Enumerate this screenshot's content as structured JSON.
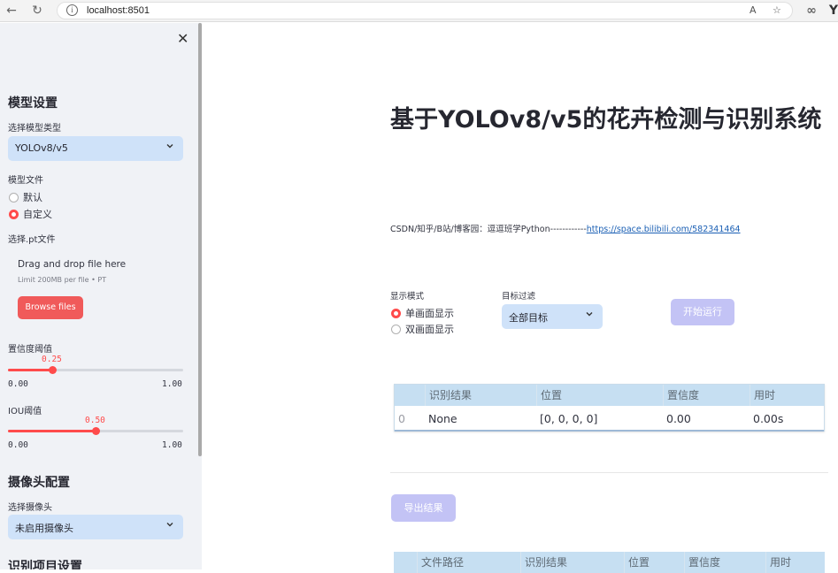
{
  "browser": {
    "url": "localhost:8501",
    "back_icon": "back-arrow-icon",
    "reload_icon": "reload-icon"
  },
  "sidebar": {
    "model_settings_heading": "模型设置",
    "model_type_label": "选择模型类型",
    "model_type_value": "YOLOv8/v5",
    "model_file_label": "模型文件",
    "model_file_options": [
      "默认",
      "自定义"
    ],
    "model_file_selected": "自定义",
    "pt_file_label": "选择.pt文件",
    "upload_text": "Drag and drop file here",
    "upload_limit": "Limit 200MB per file • PT",
    "browse_label": "Browse files",
    "conf_label": "置信度阈值",
    "conf_value": "0.25",
    "conf_fraction": 0.25,
    "conf_min": "0.00",
    "conf_max": "1.00",
    "iou_label": "IOU阈值",
    "iou_value": "0.50",
    "iou_fraction": 0.5,
    "iou_min": "0.00",
    "iou_max": "1.00",
    "camera_heading": "摄像头配置",
    "camera_label": "选择摄像头",
    "camera_value": "未启用摄像头",
    "recognition_heading": "识别项目设置"
  },
  "main": {
    "title": "基于YOLOv8/v5的花卉检测与识别系统",
    "subline_prefix": "CSDN/知乎/B站/博客园：逗逗班学Python------------",
    "subline_link": "https://space.bilibili.com/582341464",
    "display_mode_label": "显示模式",
    "display_options": [
      "单画面显示",
      "双画面显示"
    ],
    "display_selected": "单画面显示",
    "target_filter_label": "目标过滤",
    "target_filter_value": "全部目标",
    "run_label": "开始运行",
    "export_label": "导出结果",
    "results_table": {
      "headers": [
        "",
        "识别结果",
        "位置",
        "置信度",
        "用时"
      ],
      "rows": [
        [
          "0",
          "None",
          "[0, 0, 0, 0]",
          "0.00",
          "0.00s"
        ]
      ]
    },
    "files_table": {
      "headers": [
        "",
        "文件路径",
        "识别结果",
        "位置",
        "置信度",
        "用时"
      ]
    }
  },
  "colors": {
    "accent": "#ff4b4b",
    "select_bg": "#cfe2f9",
    "button_disabled": "#c3c3f5",
    "table_header": "#c6dff2",
    "sidebar_bg": "#f0f2f6"
  }
}
